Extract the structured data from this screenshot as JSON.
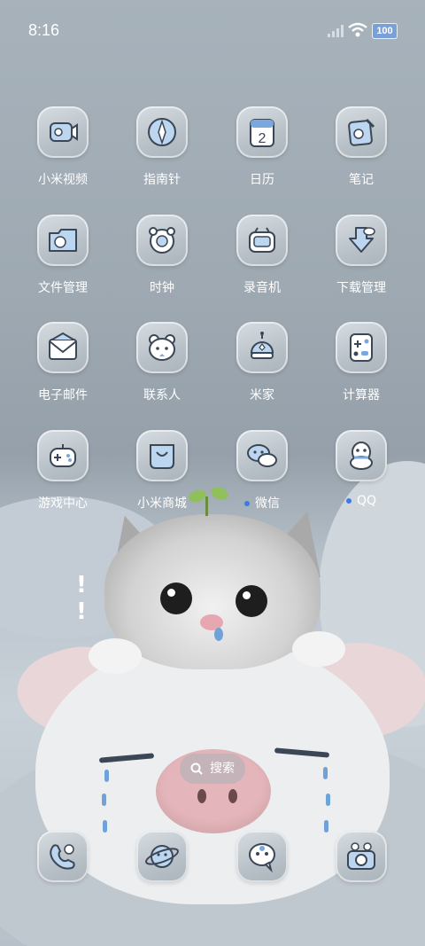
{
  "status_bar": {
    "time": "8:16",
    "battery": "100"
  },
  "apps": [
    {
      "label": "小米视频",
      "icon": "video-icon"
    },
    {
      "label": "指南针",
      "icon": "compass-icon"
    },
    {
      "label": "日历",
      "icon": "calendar-icon",
      "date": "2"
    },
    {
      "label": "笔记",
      "icon": "notes-icon"
    },
    {
      "label": "文件管理",
      "icon": "folder-icon"
    },
    {
      "label": "时钟",
      "icon": "clock-icon"
    },
    {
      "label": "录音机",
      "icon": "recorder-icon"
    },
    {
      "label": "下载管理",
      "icon": "download-icon"
    },
    {
      "label": "电子邮件",
      "icon": "mail-icon"
    },
    {
      "label": "联系人",
      "icon": "contacts-icon"
    },
    {
      "label": "米家",
      "icon": "mijia-icon"
    },
    {
      "label": "计算器",
      "icon": "calculator-icon"
    },
    {
      "label": "游戏中心",
      "icon": "gamepad-icon"
    },
    {
      "label": "小米商城",
      "icon": "shop-icon"
    },
    {
      "label": "微信",
      "icon": "wechat-icon",
      "badge": true
    },
    {
      "label": "QQ",
      "icon": "qq-icon",
      "badge": true
    }
  ],
  "search": {
    "label": "搜索"
  },
  "dock": [
    "phone-icon",
    "browser-icon",
    "messages-icon",
    "camera-icon"
  ],
  "colors": {
    "badge": "#3b7be3",
    "tile": "#c3cad0"
  }
}
